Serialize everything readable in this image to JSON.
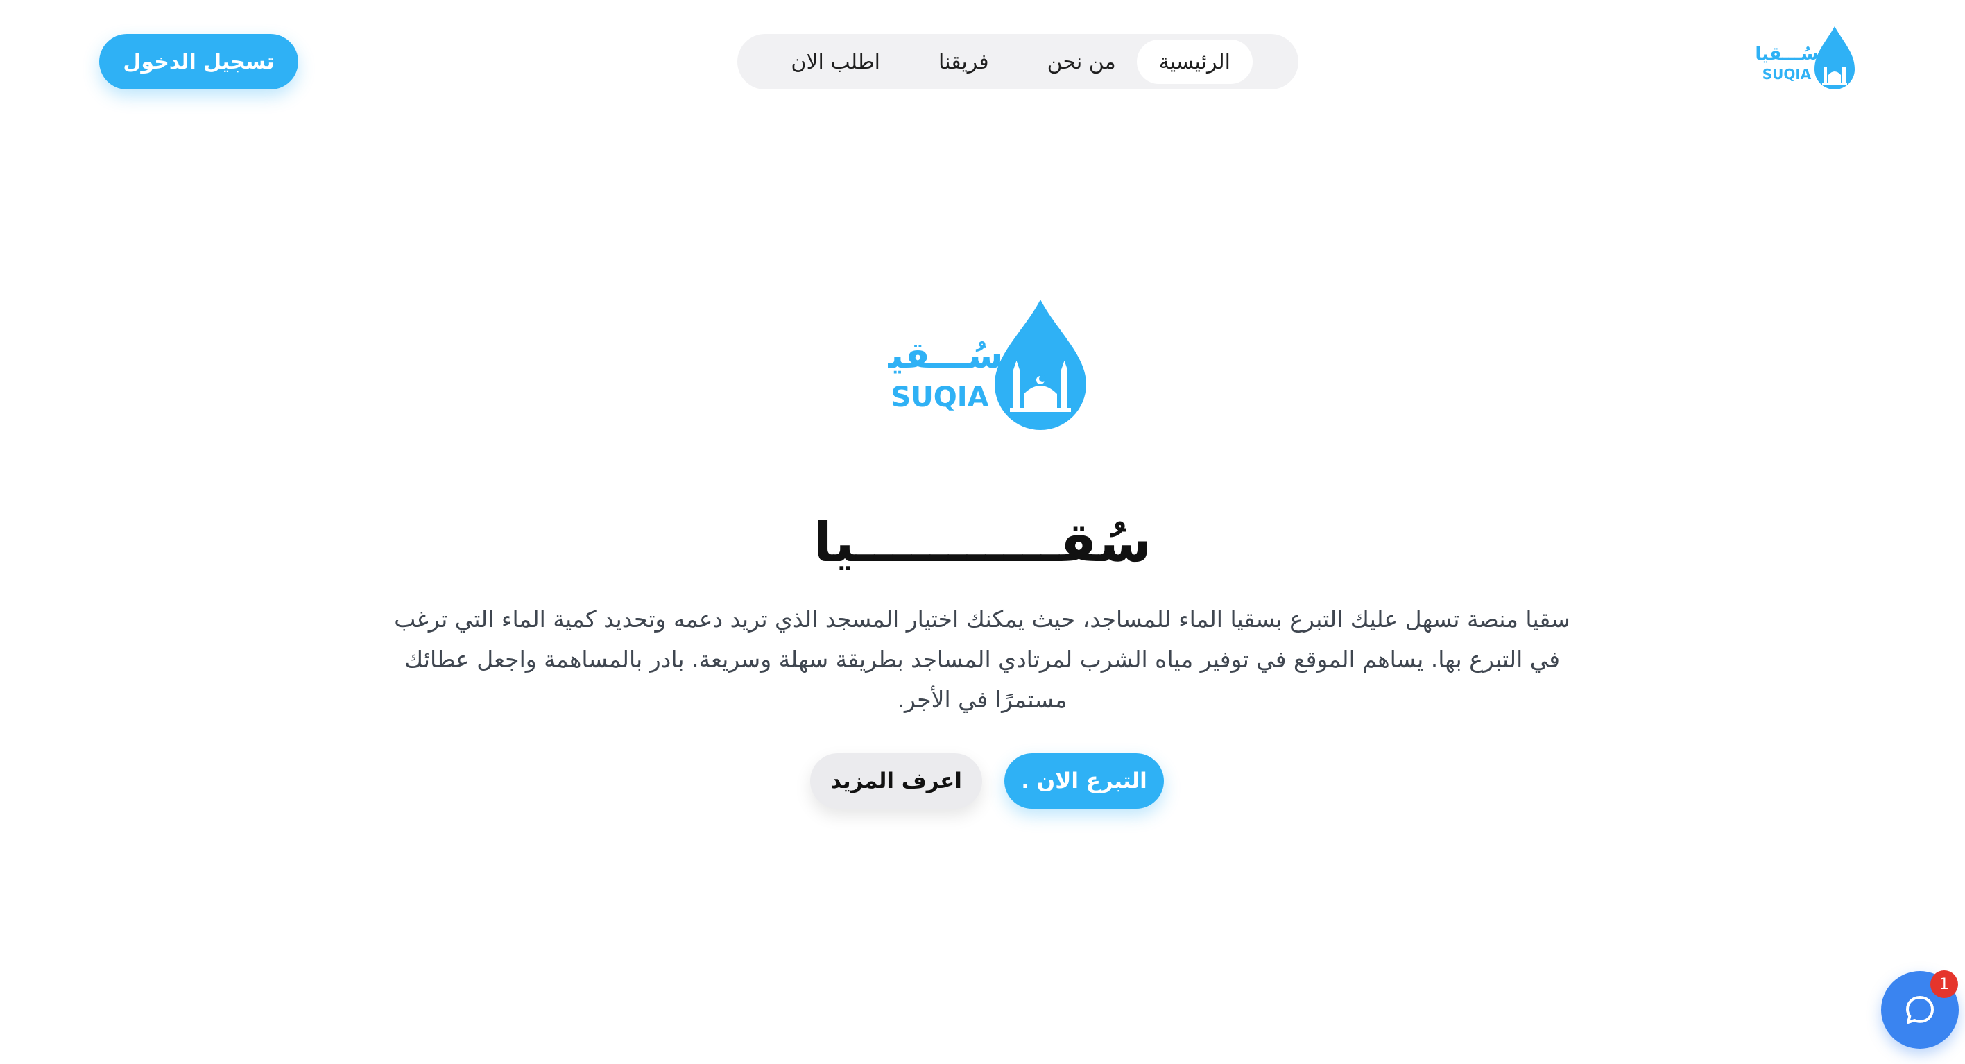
{
  "header": {
    "login_label": "تسجيل الدخول",
    "nav": [
      {
        "label": "الرئيسية",
        "active": true
      },
      {
        "label": "من نحن",
        "active": false
      },
      {
        "label": "فريقنا",
        "active": false
      },
      {
        "label": "اطلب الان",
        "active": false
      }
    ],
    "logo": {
      "arabic_text": "سُـــقيا",
      "latin_text": "SUQIA",
      "icon": "water-drop-mosque-icon"
    }
  },
  "hero": {
    "logo": {
      "arabic_text": "سُـــقيا",
      "latin_text": "SUQIA",
      "icon": "water-drop-mosque-icon"
    },
    "title": "سُقـــــــــــيا",
    "description": "سقيا منصة تسهل عليك التبرع بسقيا الماء للمساجد، حيث يمكنك اختيار المسجد الذي تريد دعمه وتحديد كمية الماء التي ترغب في التبرع بها. يساهم الموقع في توفير مياه الشرب لمرتادي المساجد بطريقة سهلة وسريعة. بادر بالمساهمة واجعل عطائك مستمرًا في الأجر.",
    "donate_label": "التبرع الان .",
    "learn_more_label": "اعرف المزيد"
  },
  "chat": {
    "icon": "chat-bubble-icon",
    "badge_count": "1"
  },
  "colors": {
    "accent": "#2fb1f5",
    "chat": "#3a84f0",
    "badge": "#e5352c",
    "nav_bg": "#f1f1f3"
  }
}
